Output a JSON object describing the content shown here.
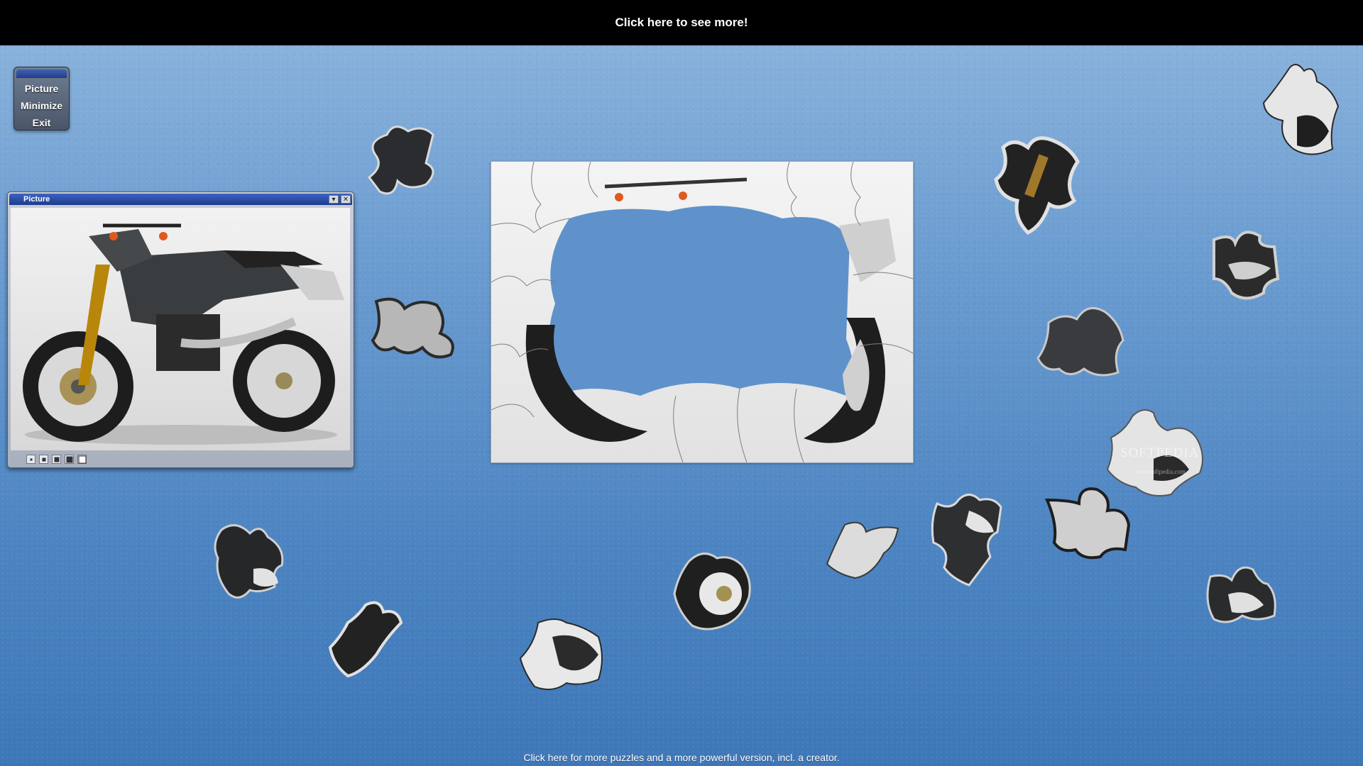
{
  "banner": {
    "text": "Click here to see more!"
  },
  "menu": {
    "items": [
      "Picture",
      "Minimize",
      "Exit"
    ]
  },
  "picture_window": {
    "title": "Picture",
    "controls": [
      "minimize-icon",
      "close-icon"
    ],
    "zoom_levels": [
      "1",
      "2",
      "3",
      "4",
      "5"
    ]
  },
  "watermark": {
    "text": "SOFTPEDIA",
    "sub": "www.softpedia.com"
  },
  "footer": {
    "text": "Click here for more puzzles and a more powerful version, incl. a creator."
  },
  "colors": {
    "banner_bg": "#000000",
    "titlebar": "#2a4ea6",
    "background": "#5a8cc6"
  }
}
